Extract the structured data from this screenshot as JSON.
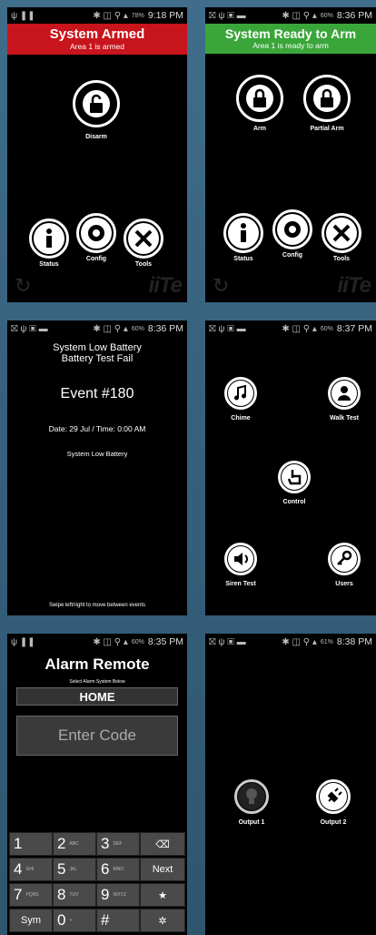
{
  "status_bar": {
    "icons_left_1": "ψ ❚❚",
    "icons_left_n": "⛝ ψ ▣ ▬",
    "icons_right": "✱ ◫ ⚲ ▴",
    "time_1": "9:18 PM",
    "time_2": "8:36 PM",
    "time_3": "8:36 PM",
    "time_4": "8:37 PM",
    "time_5": "8:35 PM",
    "time_6": "8:38 PM",
    "batt_1": "78%",
    "batt_2": "60%",
    "batt_3": "60%",
    "batt_4": "60%",
    "batt_5": "60%",
    "batt_6": "61%"
  },
  "screen1": {
    "title": "System Armed",
    "subtitle": "Area 1 is armed",
    "header_color": "#c8141c",
    "disarm": "Disarm",
    "status": "Status",
    "config": "Config",
    "tools": "Tools",
    "logo": "iiTe"
  },
  "screen2": {
    "title": "System Ready to Arm",
    "subtitle": "Area 1 is ready to arm",
    "header_color": "#3aa63a",
    "arm": "Arm",
    "partial_arm": "Partial Arm",
    "status": "Status",
    "config": "Config",
    "tools": "Tools",
    "logo": "iiTe"
  },
  "screen3": {
    "line1": "System Low Battery",
    "line2": "Battery Test Fail",
    "event": "Event #180",
    "date": "Date: 29 Jul / Time: 0:00 AM",
    "desc": "System Low Battery",
    "hint": "Swipe left/right to move between events"
  },
  "screen4": {
    "chime": "Chime",
    "walk_test": "Walk Test",
    "control": "Control",
    "siren_test": "Siren Test",
    "users": "Users"
  },
  "screen5": {
    "title": "Alarm Remote",
    "select_label": "Select Alarm System Below",
    "system": "HOME",
    "code_placeholder": "Enter Code",
    "keys": {
      "k1": "1",
      "k2": "2",
      "k2s": "ABC",
      "k3": "3",
      "k3s": "DEF",
      "del": "⌫",
      "k4": "4",
      "k4s": "GHI",
      "k5": "5",
      "k5s": "JKL",
      "k6": "6",
      "k6s": "MNO",
      "next": "Next",
      "k7": "7",
      "k7s": "PQRS",
      "k8": "8",
      "k8s": "TUV",
      "k9": "9",
      "k9s": "WXYZ",
      "star": "★",
      "sym": "Sym",
      "k0": "0",
      "k0s": "+",
      "hash": "#",
      "gear": "✲"
    }
  },
  "screen6": {
    "output1": "Output 1",
    "output2": "Output 2"
  }
}
